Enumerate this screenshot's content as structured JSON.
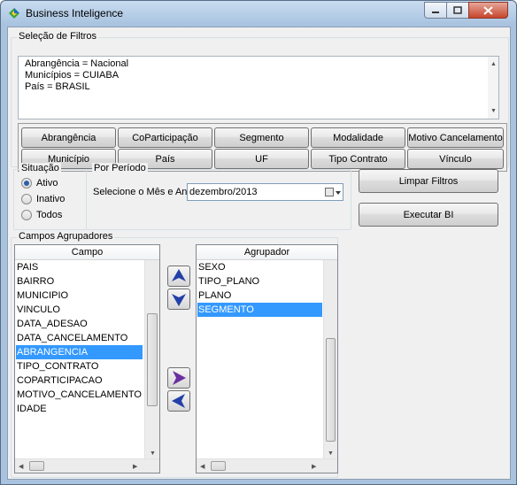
{
  "window": {
    "title": "Business Inteligence",
    "icon": "bi-app-icon",
    "controls": [
      "minimize-icon",
      "maximize-icon",
      "close-icon"
    ]
  },
  "filters": {
    "label": "Seleção de Filtros",
    "lines": [
      "Abrangência = Nacional",
      "Municípios = CUIABA",
      "País = BRASIL"
    ]
  },
  "filter_buttons": [
    [
      "Abrangência",
      "CoParticipação",
      "Segmento",
      "Modalidade",
      "Motivo Cancelamento"
    ],
    [
      "Município",
      "País",
      "UF",
      "Tipo Contrato",
      "Vínculo"
    ]
  ],
  "situacao": {
    "label": "Situação",
    "options": [
      "Ativo",
      "Inativo",
      "Todos"
    ],
    "selected": "Ativo"
  },
  "periodo": {
    "label": "Por Período",
    "prompt": "Selecione o Mês e Ano:",
    "value": "dezembro/2013"
  },
  "actions": {
    "limpar": "Limpar Filtros",
    "executar": "Executar BI"
  },
  "campos": {
    "label": "Campos Agrupadores",
    "campo_header": "Campo",
    "agrupador_header": "Agrupador",
    "campo_items": [
      "PAIS",
      "BAIRRO",
      "MUNICIPIO",
      "VINCULO",
      "DATA_ADESAO",
      "DATA_CANCELAMENTO",
      "ABRANGENCIA",
      "TIPO_CONTRATO",
      "COPARTICIPACAO",
      "MOTIVO_CANCELAMENTO",
      "IDADE"
    ],
    "campo_selected": "ABRANGENCIA",
    "agrupador_items": [
      "SEXO",
      "TIPO_PLANO",
      "PLANO",
      "SEGMENTO"
    ],
    "agrupador_selected": "SEGMENTO"
  },
  "colors": {
    "selection": "#3399ff",
    "arrow_blue": "#2340a8",
    "arrow_purple": "#6a2fa0",
    "title_gradient_top": "#c9dcf0",
    "close_red": "#c6452c"
  }
}
